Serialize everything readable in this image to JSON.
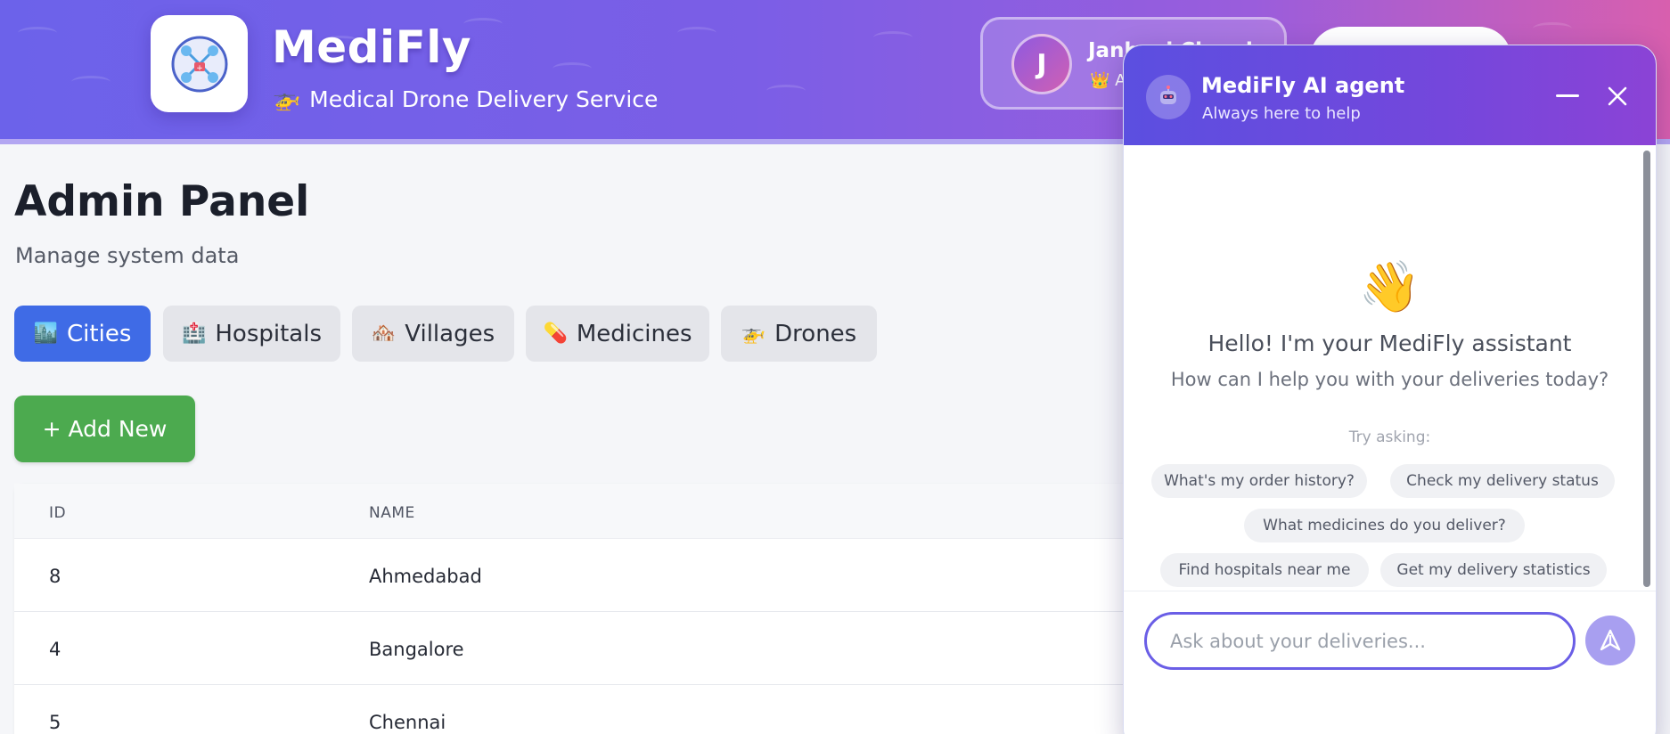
{
  "header": {
    "app_name": "MediFly",
    "tagline": "Medical Drone Delivery Service",
    "tagline_icon": "🚁",
    "user": {
      "initial": "J",
      "name": "Janhavi Chaud",
      "role": "👑 A",
      "avatar_icon": "user-avatar"
    }
  },
  "main": {
    "title": "Admin Panel",
    "subtitle": "Manage system data",
    "tabs": [
      {
        "icon": "🏙️",
        "label": "Cities",
        "active": true
      },
      {
        "icon": "🏥",
        "label": "Hospitals",
        "active": false
      },
      {
        "icon": "🏘️",
        "label": "Villages",
        "active": false
      },
      {
        "icon": "💊",
        "label": "Medicines",
        "active": false
      },
      {
        "icon": "🚁",
        "label": "Drones",
        "active": false
      }
    ],
    "add_button": "+ Add New",
    "table": {
      "columns": [
        "ID",
        "NAME"
      ],
      "rows": [
        {
          "id": "8",
          "name": "Ahmedabad"
        },
        {
          "id": "4",
          "name": "Bangalore"
        },
        {
          "id": "5",
          "name": "Chennai"
        }
      ]
    }
  },
  "chat": {
    "title": "MediFly AI agent",
    "status": "Always here to help",
    "wave_emoji": "👋",
    "greeting": "Hello! I'm your MediFly assistant",
    "greeting_sub": "How can I help you with your deliveries today?",
    "try_label": "Try asking:",
    "suggestions": [
      "What's my order history?",
      "Check my delivery status",
      "What medicines do you deliver?",
      "Find hospitals near me",
      "Get my delivery statistics"
    ],
    "input_placeholder": "Ask about your deliveries..."
  },
  "colors": {
    "primary": "#3f6be6",
    "success": "#4caa4f",
    "chat_accent": "#6a5ee6",
    "header_start": "#6c62ea",
    "header_end": "#d85fae"
  }
}
